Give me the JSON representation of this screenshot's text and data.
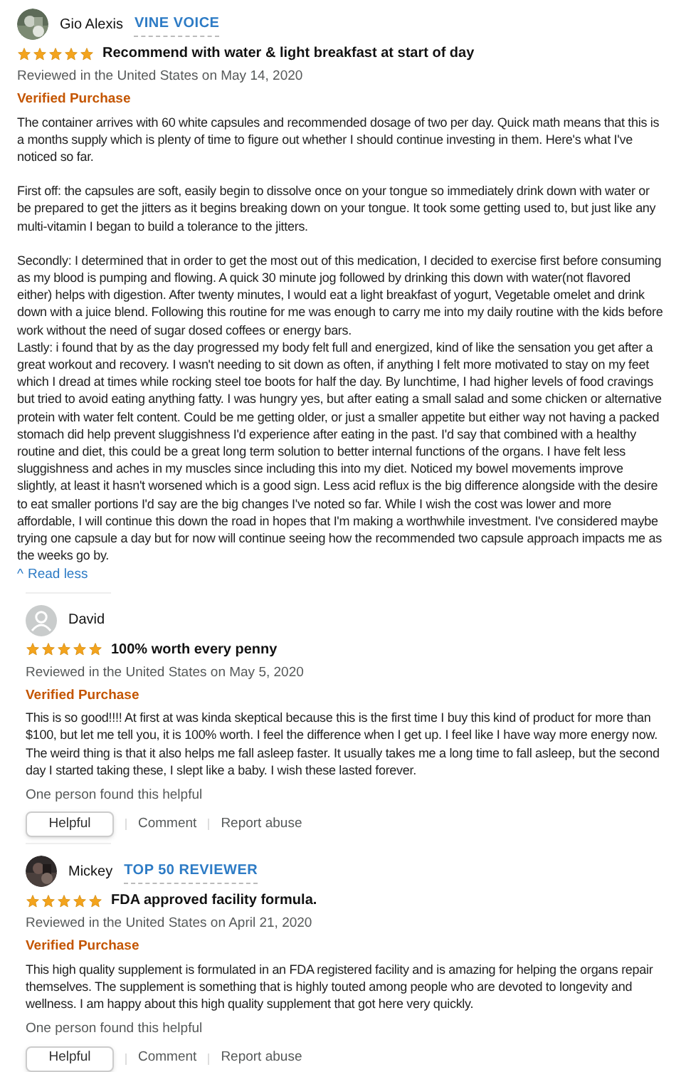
{
  "reviews": [
    {
      "reviewer": "Gio Alexis",
      "badge": "VINE VOICE",
      "stars": 5,
      "title": "Recommend with water & light breakfast at start of day",
      "date": "Reviewed in the United States on May 14, 2020",
      "verified": "Verified Purchase",
      "paragraphs": [
        "The container arrives with 60 white capsules and recommended dosage of two per day. Quick math means that this is a months supply which is plenty of time to figure out whether I should continue investing in them. Here's what I've noticed so far.",
        "First off: the capsules are soft, easily begin to dissolve once on your tongue so immediately drink down with water or be prepared to get the jitters as it begins breaking down on your tongue. It took some getting used to, but just like any multi-vitamin I began to build a tolerance to the jitters.",
        "Secondly: I determined that in order to get the most out of this medication, I decided to exercise first before consuming as my blood is pumping and flowing. A quick 30 minute jog followed by drinking this down with water(not flavored either) helps with digestion. After twenty minutes, I would eat a light breakfast of yogurt, Vegetable omelet and drink down with a juice blend. Following this routine for me was enough to carry me into my daily routine with the kids before work without the need of sugar dosed coffees or energy bars.\nLastly: i found that by as the day progressed my body felt full and energized, kind of like the sensation you get after a great workout and recovery. I wasn't needing to sit down as often, if anything I felt more motivated to stay on my feet which I dread at times while rocking steel toe boots for half the day. By lunchtime, I had higher levels of food cravings but tried to avoid eating anything fatty. I was hungry yes, but after eating a small salad and some chicken or alternative protein with water felt content. Could be me getting older, or just a smaller appetite but either way not having a packed stomach did help prevent sluggishness I'd experience after eating in the past. I'd say that combined with a healthy routine and diet, this could be a great long term solution to better internal functions of the organs. I have felt less sluggishness and aches in my muscles since including this into my diet. Noticed my bowel movements improve slightly, at least it hasn't worsened which is a good sign. Less acid reflux is the big difference alongside with the desire to eat smaller portions I'd say are the big changes I've noted so far. While I wish the cost was lower and more affordable, I will continue this down the road in hopes that I'm making a worthwhile investment. I've considered maybe trying one capsule a day but for now will continue seeing how the recommended two capsule approach impacts me as the weeks go by."
      ],
      "read_less": {
        "arrow": "^",
        "label": "Read less"
      }
    },
    {
      "reviewer": "David",
      "avatar": {
        "kind": "default"
      },
      "stars": 5,
      "title": "100% worth every penny",
      "date": "Reviewed in the United States on May 5, 2020",
      "verified": "Verified Purchase",
      "paragraphs": [
        "This is so good!!!! At first at was kinda skeptical because this is the first time I buy this kind of product for more than $100, but let me tell you, it is 100% worth. I feel the difference when I get up. I feel like I have way more energy now. The weird thing is that it also helps me fall asleep faster. It usually takes me a long time to fall asleep, but the second day I started taking these, I slept like a baby. I wish these lasted forever."
      ],
      "helpful_count": "One person found this helpful",
      "actions": [
        "Helpful",
        "Comment",
        "Report abuse"
      ]
    },
    {
      "reviewer": "Mickey",
      "badge": "TOP 50 REVIEWER",
      "stars": 5,
      "title": "FDA approved facility formula.",
      "date": "Reviewed in the United States on April 21, 2020",
      "verified": "Verified Purchase",
      "paragraphs": [
        "This high quality supplement is formulated in an FDA registered facility and is amazing for helping the organs repair themselves. The supplement is something that is highly touted among people who are devoted to longevity and wellness. I am happy about this high quality supplement that got here very quickly."
      ],
      "helpful_count": "One person found this helpful",
      "actions": [
        "Helpful",
        "Comment",
        "Report abuse"
      ]
    }
  ]
}
